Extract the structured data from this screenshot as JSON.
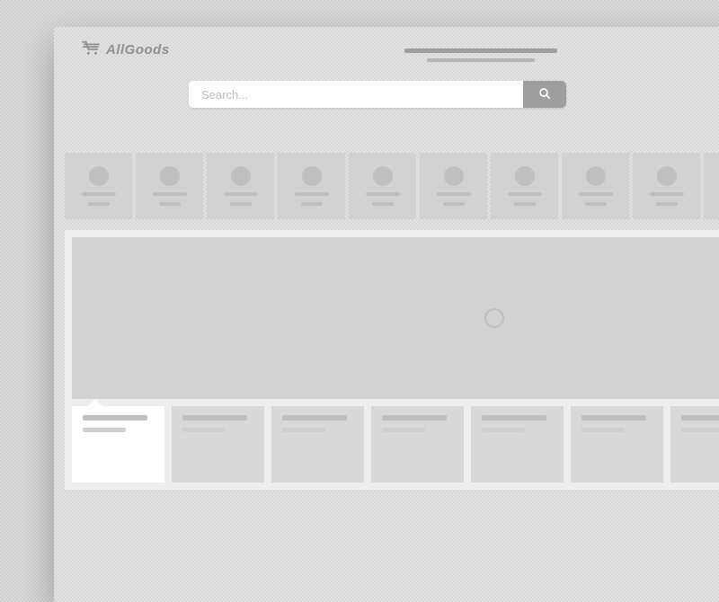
{
  "brand": {
    "name": "AllGoods"
  },
  "search": {
    "placeholder": "Search..."
  },
  "categories_count": 10,
  "products_count": 7,
  "active_product_index": 0,
  "colors": {
    "page_bg": "#cfcfcf",
    "window_bg": "#d8d8d8",
    "placeholder_block": "#d2d2d2",
    "placeholder_line": "#bfbfbf",
    "search_btn": "#9e9e9e",
    "white": "#ffffff"
  }
}
